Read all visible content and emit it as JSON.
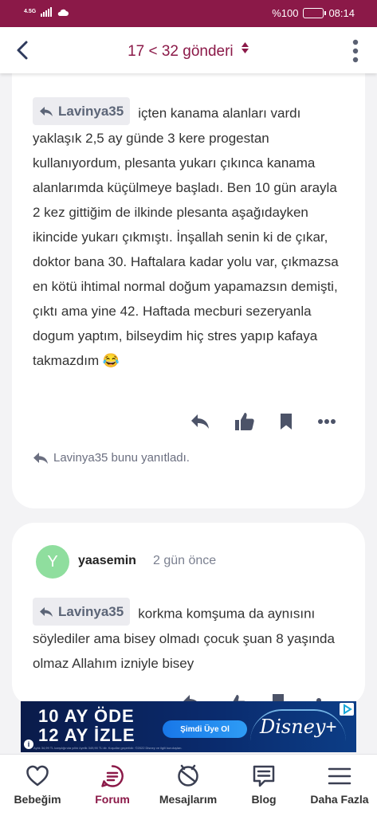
{
  "status_bar": {
    "network": "4.5G",
    "battery": "%100",
    "time": "08:14"
  },
  "header": {
    "title": "17 < 32 gönderi"
  },
  "posts": [
    {
      "quote_user": "Lavinya35",
      "text": "içten kanama alanları vardı yaklaşık 2,5 ay günde 3 kere progestan kullanıyordum, plesanta yukarı çıkınca kanama alanlarımda küçülmeye başladı. Ben 10 gün arayla 2 kez gittiğim de ilkinde plesanta aşağıdayken ikincide yukarı çıkmıştı. İnşallah senin ki de çıkar, doktor bana 30. Haftalara kadar yolu var, çıkmazsa en kötü ihtimal normal doğum yapamazsın demişti, çıktı ama yine 42. Haftada mecburi sezeryanla dogum yaptım, bilseydim hiç stres yapıp kafaya takmazdım 😂",
      "replied_note": "Lavinya35 bunu yanıtladı."
    },
    {
      "avatar_letter": "Y",
      "username": "yaasemin",
      "time": "2 gün önce",
      "quote_user": "Lavinya35",
      "text": "korkma komşuma da aynısını söylediler ama bisey olmadı çocuk şuan 8 yaşında olmaz Allahım izniyle bisey"
    }
  ],
  "ad": {
    "line1": "10 AY ÖDE",
    "line2": "12 AY İZLE",
    "cta": "Şimdi Üye Ol",
    "brand": "Disney",
    "brand_plus": "+",
    "legal": "Aylık 34,99 TL karşılığında yıllık üyelik 349,90 TL'dir. Koşullar geçerlidir. ©2022 Disney ve ilgili kuruluşları."
  },
  "bottom_nav": [
    {
      "label": "Bebeğim",
      "icon": "heart-icon"
    },
    {
      "label": "Forum",
      "icon": "forum-icon"
    },
    {
      "label": "Mesajlarım",
      "icon": "messages-icon"
    },
    {
      "label": "Blog",
      "icon": "blog-icon"
    },
    {
      "label": "Daha Fazla",
      "icon": "menu-icon"
    }
  ],
  "colors": {
    "brand": "#8b1948",
    "avatar": "#8fde9e",
    "chip_bg": "#ececf0"
  }
}
